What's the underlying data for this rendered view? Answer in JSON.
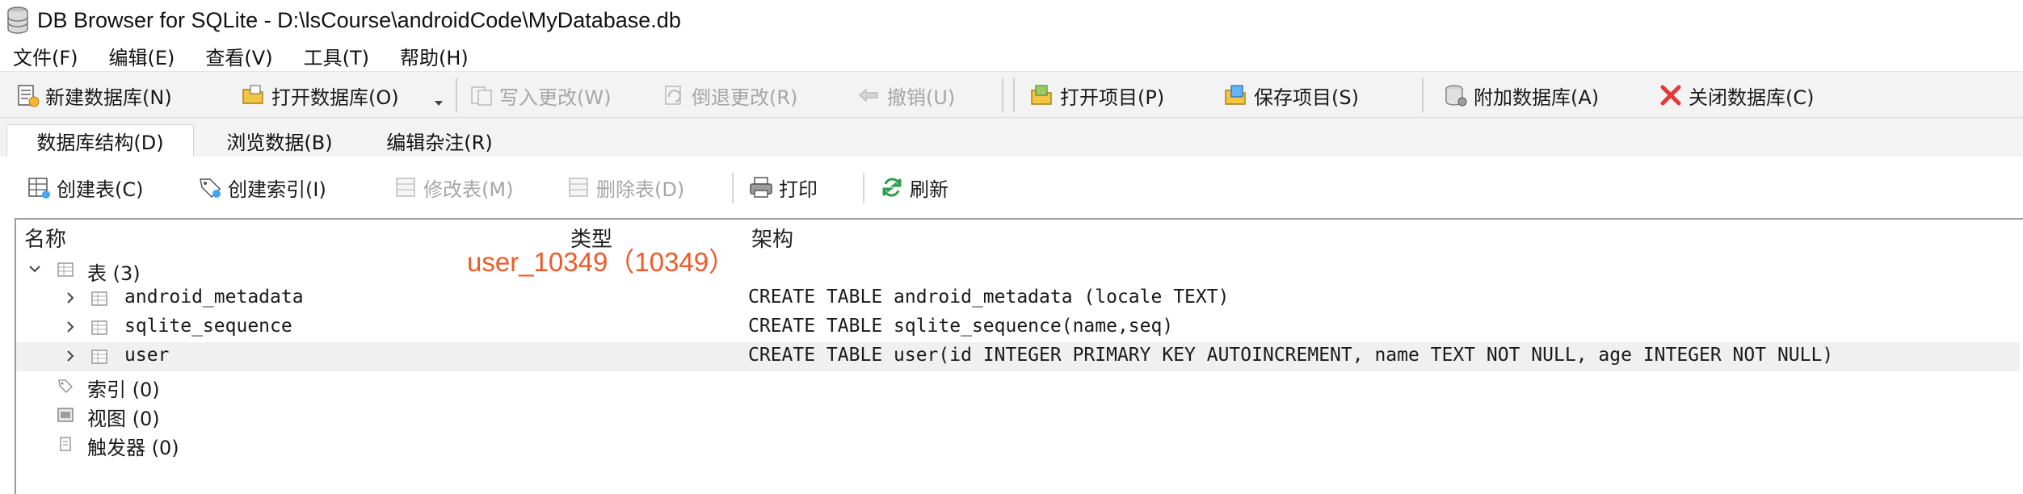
{
  "window": {
    "title": "DB Browser for SQLite - D:\\lsCourse\\androidCode\\MyDatabase.db"
  },
  "menu": [
    "文件(F)",
    "编辑(E)",
    "查看(V)",
    "工具(T)",
    "帮助(H)"
  ],
  "toolbar": {
    "new_db": "新建数据库(N)",
    "open_db": "打开数据库(O)",
    "write_changes": "写入更改(W)",
    "revert_changes": "倒退更改(R)",
    "undo": "撤销(U)",
    "open_project": "打开项目(P)",
    "save_project": "保存项目(S)",
    "attach_db": "附加数据库(A)",
    "close_db": "关闭数据库(C)"
  },
  "tabs": [
    "数据库结构(D)",
    "浏览数据(B)",
    "编辑杂注(R)"
  ],
  "structure_toolbar": {
    "create_table": "创建表(C)",
    "create_index": "创建索引(I)",
    "modify_table": "修改表(M)",
    "delete_table": "删除表(D)",
    "print": "打印",
    "refresh": "刷新"
  },
  "tree": {
    "headers": {
      "name": "名称",
      "type": "类型",
      "schema": "架构"
    },
    "tables_group": "表 (3)",
    "tables": [
      {
        "name": "android_metadata",
        "schema": "CREATE TABLE android_metadata (locale TEXT)"
      },
      {
        "name": "sqlite_sequence",
        "schema": "CREATE TABLE sqlite_sequence(name,seq)"
      },
      {
        "name": "user",
        "schema": "CREATE TABLE user(id INTEGER PRIMARY KEY AUTOINCREMENT, name TEXT NOT NULL, age INTEGER NOT NULL)"
      }
    ],
    "indices_group": "索引 (0)",
    "views_group": "视图 (0)",
    "triggers_group": "触发器 (0)"
  },
  "overlay": {
    "text": "user_10349（10349）"
  },
  "colors": {
    "overlay": "#f05a28",
    "close_icon": "#e53935"
  }
}
